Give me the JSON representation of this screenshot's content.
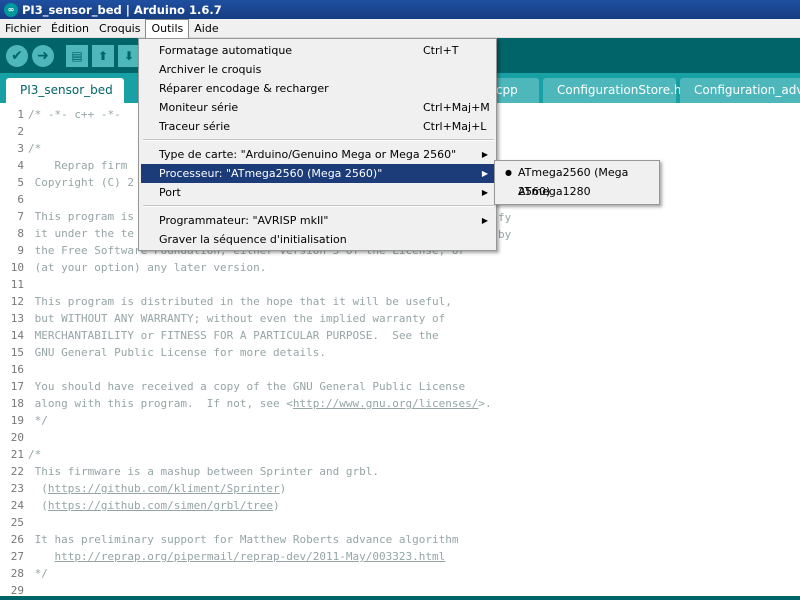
{
  "window": {
    "title": "PI3_sensor_bed | Arduino 1.6.7",
    "logo_text": "∞"
  },
  "menubar": {
    "items": [
      "Fichier",
      "Édition",
      "Croquis",
      "Outils",
      "Aide"
    ]
  },
  "toolbar": {
    "verify_icon": "✔",
    "upload_icon": "➜",
    "new_icon": "▤",
    "open_icon": "⬆",
    "save_icon": "⬇"
  },
  "tabs": {
    "active": "PI3_sensor_bed",
    "partial": "re.cpp",
    "items": [
      "ConfigurationStore.h",
      "Configuration_adv.h"
    ]
  },
  "outils_menu": {
    "items": [
      {
        "label": "Formatage automatique",
        "shortcut": "Ctrl+T"
      },
      {
        "label": "Archiver le croquis",
        "shortcut": ""
      },
      {
        "label": "Réparer encodage & recharger",
        "shortcut": ""
      },
      {
        "label": "Moniteur série",
        "shortcut": "Ctrl+Maj+M"
      },
      {
        "label": "Traceur série",
        "shortcut": "Ctrl+Maj+L"
      },
      {
        "label": "Type de carte: \"Arduino/Genuino Mega or Mega 2560\"",
        "shortcut": ""
      },
      {
        "label": "Processeur: \"ATmega2560 (Mega 2560)\"",
        "shortcut": ""
      },
      {
        "label": "Port",
        "shortcut": ""
      },
      {
        "label": "Programmateur: \"AVRISP mkII\"",
        "shortcut": ""
      },
      {
        "label": "Graver la séquence d'initialisation",
        "shortcut": ""
      }
    ],
    "submenu_arrow": "▶"
  },
  "processor_submenu": {
    "items": [
      {
        "label": "ATmega2560 (Mega 2560)",
        "selected": true
      },
      {
        "label": "ATmega1280",
        "selected": false
      }
    ],
    "bullet": "●"
  },
  "editor": {
    "lines": [
      {
        "n": "1",
        "text": "/* -*- c++ -*- "
      },
      {
        "n": "2",
        "text": ""
      },
      {
        "n": "3",
        "text": "/*"
      },
      {
        "n": "4",
        "text": "    Reprap firm"
      },
      {
        "n": "5",
        "text": " Copyright (C) 2"
      },
      {
        "n": "6",
        "text": ""
      },
      {
        "n": "7",
        "text": " This program is"
      },
      {
        "n": "8",
        "text": " it under the te"
      },
      {
        "n": "9",
        "text": " the Free Software Foundation, either version 3 of the License, or"
      },
      {
        "n": "10",
        "text": " (at your option) any later version."
      },
      {
        "n": "11",
        "text": ""
      },
      {
        "n": "12",
        "text": " This program is distributed in the hope that it will be useful,"
      },
      {
        "n": "13",
        "text": " but WITHOUT ANY WARRANTY; without even the implied warranty of"
      },
      {
        "n": "14",
        "text": " MERCHANTABILITY or FITNESS FOR A PARTICULAR PURPOSE.  See the"
      },
      {
        "n": "15",
        "text": " GNU General Public License for more details."
      },
      {
        "n": "16",
        "text": ""
      },
      {
        "n": "17",
        "text": " You should have received a copy of the GNU General Public License"
      },
      {
        "n": "18",
        "text": " along with this program.  If not, see <http://www.gnu.org/licenses/>."
      },
      {
        "n": "19",
        "text": " */"
      },
      {
        "n": "20",
        "text": ""
      },
      {
        "n": "21",
        "text": "/*"
      },
      {
        "n": "22",
        "text": " This firmware is a mashup between Sprinter and grbl."
      },
      {
        "n": "23",
        "text": "  (https://github.com/kliment/Sprinter)"
      },
      {
        "n": "24",
        "text": "  (https://github.com/simen/grbl/tree)"
      },
      {
        "n": "25",
        "text": ""
      },
      {
        "n": "26",
        "text": " It has preliminary support for Matthew Roberts advance algorithm"
      },
      {
        "n": "27",
        "text": "    http://reprap.org/pipermail/reprap-dev/2011-May/003323.html"
      },
      {
        "n": "28",
        "text": " */"
      },
      {
        "n": "29",
        "text": ""
      }
    ],
    "tail_8": "by",
    "tail_7": "fy"
  },
  "colors": {
    "toolbar": "#006468",
    "tabstrip": "#17a1a5",
    "highlight": "#1b3c78"
  }
}
